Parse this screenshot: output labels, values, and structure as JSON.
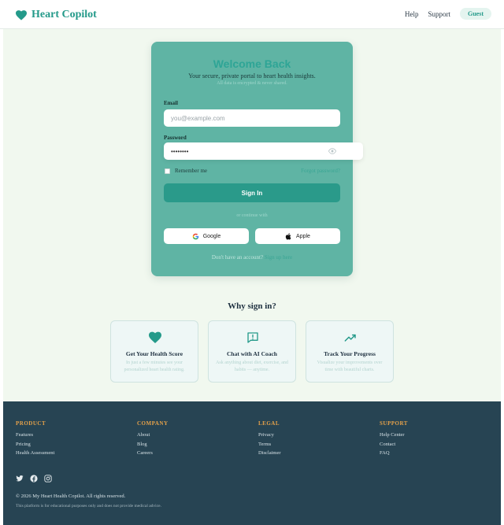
{
  "header": {
    "brand": "Heart Copilot",
    "nav": [
      "Help",
      "Support"
    ],
    "guest": "Guest"
  },
  "login": {
    "title": "Welcome Back",
    "subtitle": "Your secure, private portal to heart health insights.",
    "note": "All data is encrypted & never shared.",
    "email_label": "Email",
    "email_placeholder": "you@example.com",
    "password_label": "Password",
    "password_value": "••••••••",
    "remember": "Remember me",
    "forgot": "Forgot password?",
    "sign_in": "Sign In",
    "or_continue": "or continue with",
    "google": "Google",
    "apple": "Apple",
    "no_account": "Don't have an account?",
    "sign_up": "Sign up here"
  },
  "why": {
    "title": "Why sign in?",
    "features": [
      {
        "title": "Get Your Health Score",
        "desc": "In just a few minutes see your personalized heart health rating."
      },
      {
        "title": "Chat with AI Coach",
        "desc": "Ask anything about diet, exercise, and habits — anytime."
      },
      {
        "title": "Track Your Progress",
        "desc": "Visualize your improvements over time with beautiful charts."
      }
    ]
  },
  "footer": {
    "columns": [
      {
        "title": "PRODUCT",
        "links": [
          "Features",
          "Pricing",
          "Health Assessment"
        ]
      },
      {
        "title": "COMPANY",
        "links": [
          "About",
          "Blog",
          "Careers"
        ]
      },
      {
        "title": "LEGAL",
        "links": [
          "Privacy",
          "Terms",
          "Disclaimer"
        ]
      },
      {
        "title": "SUPPORT",
        "links": [
          "Help Center",
          "Contact",
          "FAQ"
        ]
      }
    ],
    "copyright": "© 2026 My Heart Health Copilot. All rights reserved.",
    "disclaimer": "This platform is for educational purposes only and does not provide medical advice."
  },
  "colors": {
    "brand": "#249a8a",
    "card": "#5fb4a4",
    "footer": "#274453",
    "footer_heading": "#e6a24a"
  }
}
